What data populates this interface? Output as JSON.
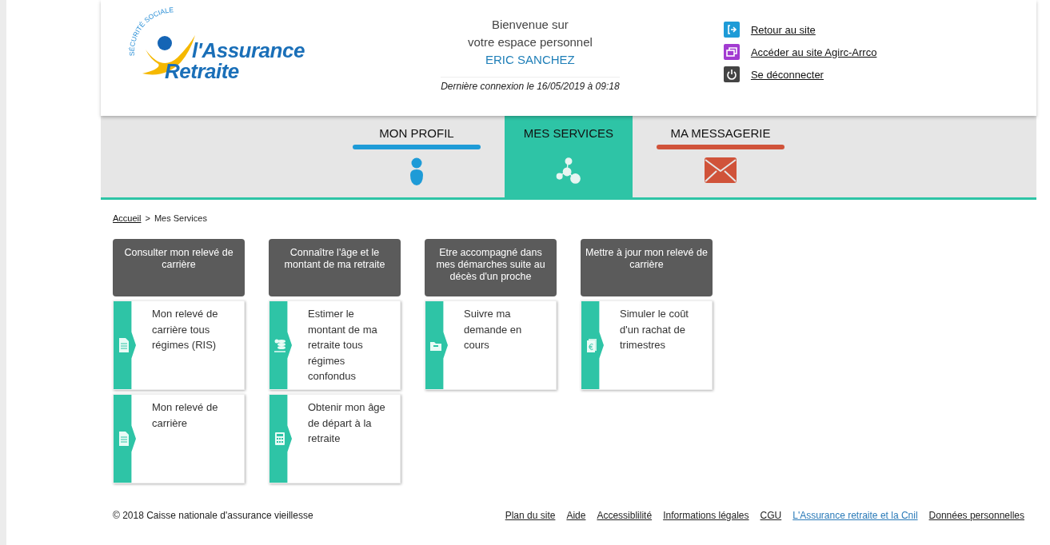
{
  "header": {
    "logo": {
      "arc_text": "SÉCURITÉ SOCIALE",
      "line1": "l'Assurance",
      "line2": "Retraite"
    },
    "welcome": [
      "Bienvenue sur",
      "votre espace personnel"
    ],
    "user_name": "ERIC SANCHEZ",
    "last_login": "Dernière connexion le 16/05/2019 à 09:18",
    "links": [
      {
        "label": "Retour au site",
        "kind": "exit"
      },
      {
        "label": "Accéder au site Agirc-Arrco",
        "kind": "window"
      },
      {
        "label": "Se déconnecter",
        "kind": "power"
      }
    ]
  },
  "tabs": [
    {
      "label": "MON PROFIL",
      "selected": false,
      "kind": "profile",
      "color": "#1e9bd7"
    },
    {
      "label": "MES SERVICES",
      "selected": true,
      "kind": "services",
      "color": "#2ec4a6"
    },
    {
      "label": "MA MESSAGERIE",
      "selected": false,
      "kind": "messages",
      "color": "#d0533a"
    }
  ],
  "breadcrumb": {
    "separator": ">",
    "items": [
      {
        "label": "Accueil",
        "kind": "link"
      },
      {
        "label": "Mes Services",
        "kind": "current"
      }
    ]
  },
  "columns": [
    {
      "title": "Consulter mon relevé de carrière",
      "services": [
        {
          "label": "Mon relevé de carrière tous régimes (RIS)",
          "kind": "document-stamp"
        },
        {
          "label": "Mon relevé de carrière",
          "kind": "document"
        }
      ]
    },
    {
      "title": "Connaître l'âge et le montant de ma retraite",
      "services": [
        {
          "label": "Estimer le montant de ma retraite tous régimes confondus",
          "kind": "coins"
        },
        {
          "label": "Obtenir mon âge de départ à la retraite",
          "kind": "calculator"
        }
      ]
    },
    {
      "title": "Etre accompagné dans mes démarches suite au décès d'un proche",
      "services": [
        {
          "label": "Suivre ma demande en cours",
          "kind": "folder"
        }
      ]
    },
    {
      "title": "Mettre à jour mon relevé de carrière",
      "services": [
        {
          "label": "Simuler le coût d'un rachat de trimestres",
          "kind": "euro"
        }
      ]
    }
  ],
  "footer": {
    "copyright": "© 2018 Caisse nationale d'assurance vieillesse",
    "links": [
      {
        "label": "Plan du site",
        "kind": "plain"
      },
      {
        "label": "Aide",
        "kind": "plain"
      },
      {
        "label": "Accessiblilité",
        "kind": "plain"
      },
      {
        "label": "Informations légales",
        "kind": "plain"
      },
      {
        "label": "CGU",
        "kind": "plain"
      },
      {
        "label": "L'Assurance retraite et la Cnil",
        "kind": "accent"
      },
      {
        "label": "Données personnelles",
        "kind": "plain"
      }
    ]
  }
}
